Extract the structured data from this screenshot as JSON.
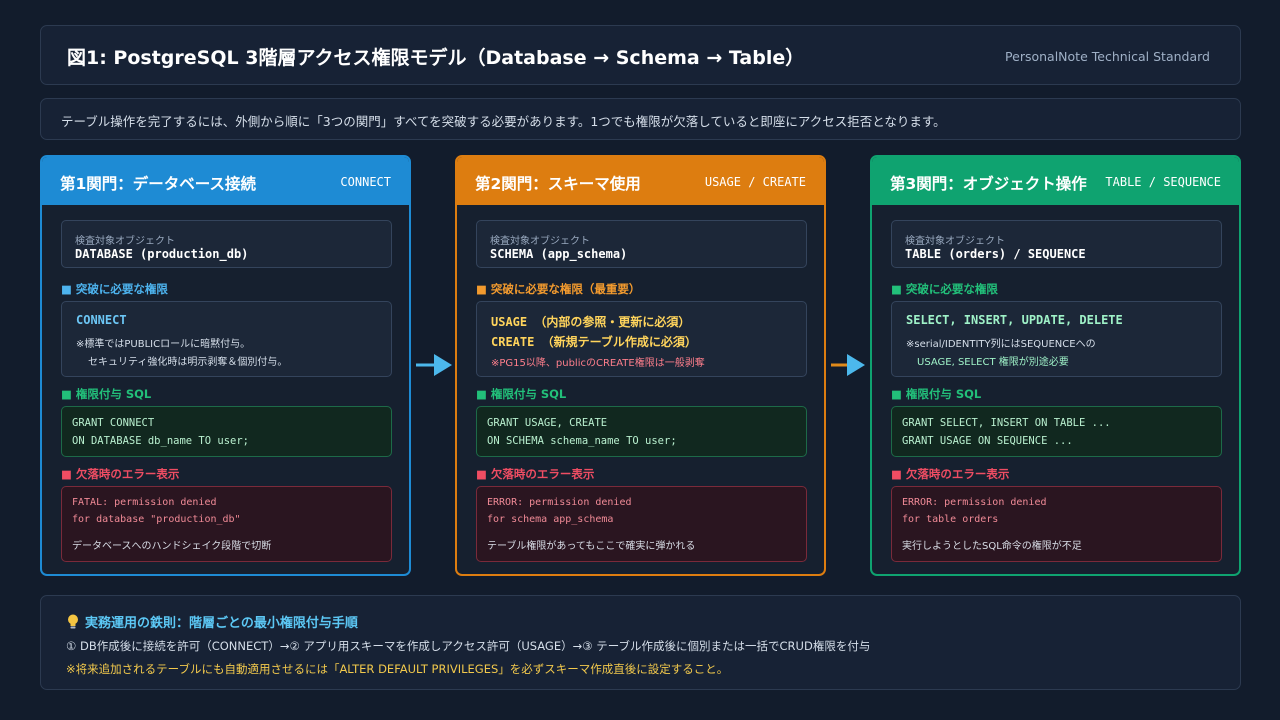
{
  "header": {
    "title": "図1: PostgreSQL 3階層アクセス権限モデル（Database → Schema → Table）",
    "subtitle": "PersonalNote Technical Standard"
  },
  "intro": "テーブル操作を完了するには、外側から順に「3つの関門」すべてを突破する必要があります。1つでも権限が欠落していると即座にアクセス拒否となります。",
  "colors": {
    "gate1": "#1e8bd4",
    "gate2": "#dd7d10",
    "gate3": "#0fa370",
    "arrow": "#4cb8ec",
    "sql_label": "#22c07a",
    "error_label": "#ef4d63",
    "warning_text": "#ff7f8c"
  },
  "gates": [
    {
      "name": "第1関門：データベース接続",
      "tag": "CONNECT",
      "object_label": "検査対象オブジェクト",
      "object_value": "DATABASE (production_db)",
      "perm_label": "■ 突破に必要な権限",
      "perm_lines": [
        "CONNECT"
      ],
      "perm_notes": [
        "※標準ではPUBLICロールに暗黙付与。",
        "セキュリティ強化時は明示剥奪＆個別付与。"
      ],
      "sql_label": "■ 権限付与 SQL",
      "sql_lines": [
        "GRANT CONNECT",
        "ON DATABASE db_name TO user;"
      ],
      "error_label": "■ 欠落時のエラー表示",
      "error_lines": [
        "FATAL: permission denied",
        "for database \"production_db\""
      ],
      "error_desc": "データベースへのハンドシェイク段階で切断"
    },
    {
      "name": "第2関門：スキーマ使用",
      "tag": "USAGE / CREATE",
      "object_label": "検査対象オブジェクト",
      "object_value": "SCHEMA (app_schema)",
      "perm_label": "■ 突破に必要な権限（最重要）",
      "perm_lines": [
        "USAGE （内部の参照・更新に必須）",
        "CREATE （新規テーブル作成に必須）"
      ],
      "perm_notes": [
        "※PG15以降、publicのCREATE権限は一般剥奪"
      ],
      "sql_label": "■ 権限付与 SQL",
      "sql_lines": [
        "GRANT USAGE, CREATE",
        "ON SCHEMA schema_name TO user;"
      ],
      "error_label": "■ 欠落時のエラー表示",
      "error_lines": [
        "ERROR: permission denied",
        "for schema app_schema"
      ],
      "error_desc": "テーブル権限があってもここで確実に弾かれる"
    },
    {
      "name": "第3関門：オブジェクト操作",
      "tag": "TABLE / SEQUENCE",
      "object_label": "検査対象オブジェクト",
      "object_value": "TABLE (orders) / SEQUENCE",
      "perm_label": "■ 突破に必要な権限",
      "perm_lines": [
        "SELECT, INSERT, UPDATE, DELETE"
      ],
      "perm_notes": [
        "※serial/IDENTITY列にはSEQUENCEへの",
        "USAGE, SELECT 権限が別途必要"
      ],
      "sql_label": "■ 権限付与 SQL",
      "sql_lines": [
        "GRANT SELECT, INSERT ON TABLE ...",
        "GRANT USAGE ON SEQUENCE ..."
      ],
      "error_label": "■ 欠落時のエラー表示",
      "error_lines": [
        "ERROR: permission denied",
        "for table orders"
      ],
      "error_desc": "実行しようとしたSQL命令の権限が不足"
    }
  ],
  "tips": {
    "icon": "lightbulb-icon",
    "title": "実務運用の鉄則：階層ごとの最小権限付与手順",
    "line1": "① DB作成後に接続を許可（CONNECT）→② アプリ用スキーマを作成しアクセス許可（USAGE）→③ テーブル作成後に個別または一括でCRUD権限を付与",
    "line2": "※将来追加されるテーブルにも自動適用させるには「ALTER DEFAULT PRIVILEGES」を必ずスキーマ作成直後に設定すること。"
  }
}
